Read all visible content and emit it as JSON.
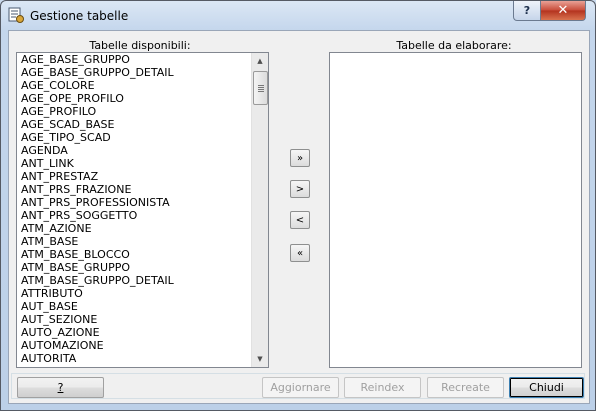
{
  "window": {
    "title": "Gestione tabelle",
    "help_label": "?",
    "close_label": "✕"
  },
  "left_panel": {
    "label": "Tabelle disponibili:",
    "items": [
      "AGE_BASE_GRUPPO",
      "AGE_BASE_GRUPPO_DETAIL",
      "AGE_COLORE",
      "AGE_OPE_PROFILO",
      "AGE_PROFILO",
      "AGE_SCAD_BASE",
      "AGE_TIPO_SCAD",
      "AGENDA",
      "ANT_LINK",
      "ANT_PRESTAZ",
      "ANT_PRS_FRAZIONE",
      "ANT_PRS_PROFESSIONISTA",
      "ANT_PRS_SOGGETTO",
      "ATM_AZIONE",
      "ATM_BASE",
      "ATM_BASE_BLOCCO",
      "ATM_BASE_GRUPPO",
      "ATM_BASE_GRUPPO_DETAIL",
      "ATTRIBUTO",
      "AUT_BASE",
      "AUT_SEZIONE",
      "AUTO_AZIONE",
      "AUTOMAZIONE",
      "AUTORITA"
    ]
  },
  "right_panel": {
    "label": "Tabelle da elaborare:",
    "items": []
  },
  "move_buttons": {
    "add_all": "»",
    "add": ">",
    "remove": "<",
    "remove_all": "«"
  },
  "bottom_buttons": {
    "help": "?",
    "update": "Aggiornare",
    "reindex": "Reindex",
    "recreate": "Recreate",
    "close": "Chiudi"
  }
}
